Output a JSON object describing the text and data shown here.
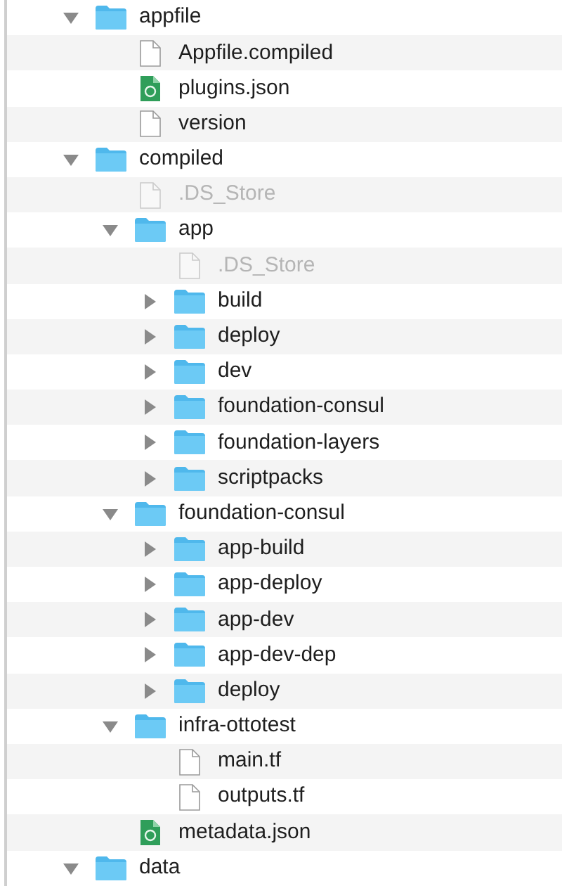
{
  "items": [
    {
      "name": "appfile",
      "kind": "folder",
      "hidden": false,
      "expanded": true,
      "children": [
        {
          "name": "Appfile.compiled",
          "kind": "file",
          "hidden": false
        },
        {
          "name": "plugins.json",
          "kind": "json",
          "hidden": false
        },
        {
          "name": "version",
          "kind": "file",
          "hidden": false
        }
      ]
    },
    {
      "name": "compiled",
      "kind": "folder",
      "hidden": false,
      "expanded": true,
      "children": [
        {
          "name": ".DS_Store",
          "kind": "file",
          "hidden": true
        },
        {
          "name": "app",
          "kind": "folder",
          "hidden": false,
          "expanded": true,
          "children": [
            {
              "name": ".DS_Store",
              "kind": "file",
              "hidden": true
            },
            {
              "name": "build",
              "kind": "folder",
              "hidden": false,
              "expanded": false
            },
            {
              "name": "deploy",
              "kind": "folder",
              "hidden": false,
              "expanded": false
            },
            {
              "name": "dev",
              "kind": "folder",
              "hidden": false,
              "expanded": false
            },
            {
              "name": "foundation-consul",
              "kind": "folder",
              "hidden": false,
              "expanded": false
            },
            {
              "name": "foundation-layers",
              "kind": "folder",
              "hidden": false,
              "expanded": false
            },
            {
              "name": "scriptpacks",
              "kind": "folder",
              "hidden": false,
              "expanded": false
            }
          ]
        },
        {
          "name": "foundation-consul",
          "kind": "folder",
          "hidden": false,
          "expanded": true,
          "children": [
            {
              "name": "app-build",
              "kind": "folder",
              "hidden": false,
              "expanded": false
            },
            {
              "name": "app-deploy",
              "kind": "folder",
              "hidden": false,
              "expanded": false
            },
            {
              "name": "app-dev",
              "kind": "folder",
              "hidden": false,
              "expanded": false
            },
            {
              "name": "app-dev-dep",
              "kind": "folder",
              "hidden": false,
              "expanded": false
            },
            {
              "name": "deploy",
              "kind": "folder",
              "hidden": false,
              "expanded": false
            }
          ]
        },
        {
          "name": "infra-ottotest",
          "kind": "folder",
          "hidden": false,
          "expanded": true,
          "children": [
            {
              "name": "main.tf",
              "kind": "file",
              "hidden": false
            },
            {
              "name": "outputs.tf",
              "kind": "file",
              "hidden": false
            }
          ]
        },
        {
          "name": "metadata.json",
          "kind": "json",
          "hidden": false
        }
      ]
    },
    {
      "name": "data",
      "kind": "folder",
      "hidden": false,
      "expanded": true
    }
  ]
}
